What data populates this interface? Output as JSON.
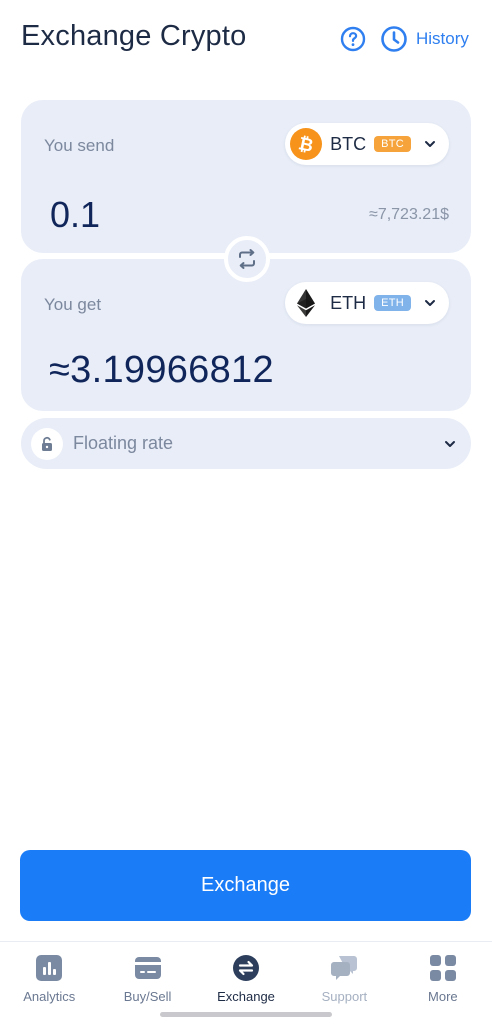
{
  "header": {
    "title": "Exchange Crypto",
    "history_label": "History"
  },
  "send": {
    "label": "You send",
    "coin": "BTC",
    "badge": "BTC",
    "amount": "0.1",
    "fiat_value": "≈7,723.21$"
  },
  "get": {
    "label": "You get",
    "coin": "ETH",
    "badge": "ETH",
    "amount": "≈3.19966812"
  },
  "rate": {
    "label": "Floating rate"
  },
  "action": {
    "exchange_label": "Exchange"
  },
  "nav": {
    "items": [
      {
        "label": "Analytics",
        "icon": "analytics-icon"
      },
      {
        "label": "Buy/Sell",
        "icon": "card-icon"
      },
      {
        "label": "Exchange",
        "icon": "exchange-icon",
        "active": true
      },
      {
        "label": "Support",
        "icon": "chat-icon"
      },
      {
        "label": "More",
        "icon": "grid-icon"
      }
    ]
  },
  "colors": {
    "accent": "#1a7cf7",
    "card_bg": "#e8edf7",
    "btc_orange": "#f7931a",
    "eth_badge": "#7fb3ea"
  }
}
